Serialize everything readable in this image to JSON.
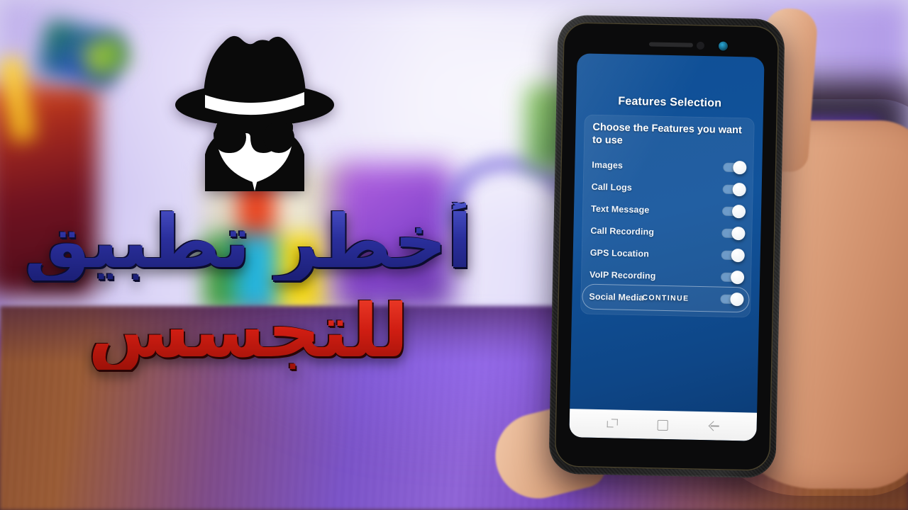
{
  "overlay": {
    "logo_icon": "incognito-spy-icon",
    "headline_line1": "أخطر تطبيق",
    "headline_line2": "للتجسس",
    "headline_line1_color": "#2b2f9e",
    "headline_line2_color": "#cf1d12"
  },
  "phone": {
    "hardware": {
      "earpiece": "earpiece-speaker",
      "sensor": "proximity-sensor",
      "front_camera": "front-camera"
    },
    "navbar": {
      "recents_label": "recents-icon",
      "home_label": "home-icon",
      "back_label": "back-icon"
    }
  },
  "app": {
    "title": "Features Selection",
    "card": {
      "subtitle": "Choose the Features you want to use",
      "features": [
        {
          "label": "Images",
          "enabled": true
        },
        {
          "label": "Call Logs",
          "enabled": true
        },
        {
          "label": "Text Message",
          "enabled": true
        },
        {
          "label": "Call Recording",
          "enabled": true
        },
        {
          "label": "GPS Location",
          "enabled": true
        },
        {
          "label": "VoIP Recording",
          "enabled": true
        },
        {
          "label": "Social Media",
          "enabled": true
        }
      ]
    },
    "continue_label": "CONTINUE",
    "colors": {
      "screen_blue": "#11539b",
      "card_overlay": "rgba(255,255,255,0.075)",
      "toggle_track": "#a0c4e6",
      "toggle_knob": "#ffffff"
    }
  }
}
